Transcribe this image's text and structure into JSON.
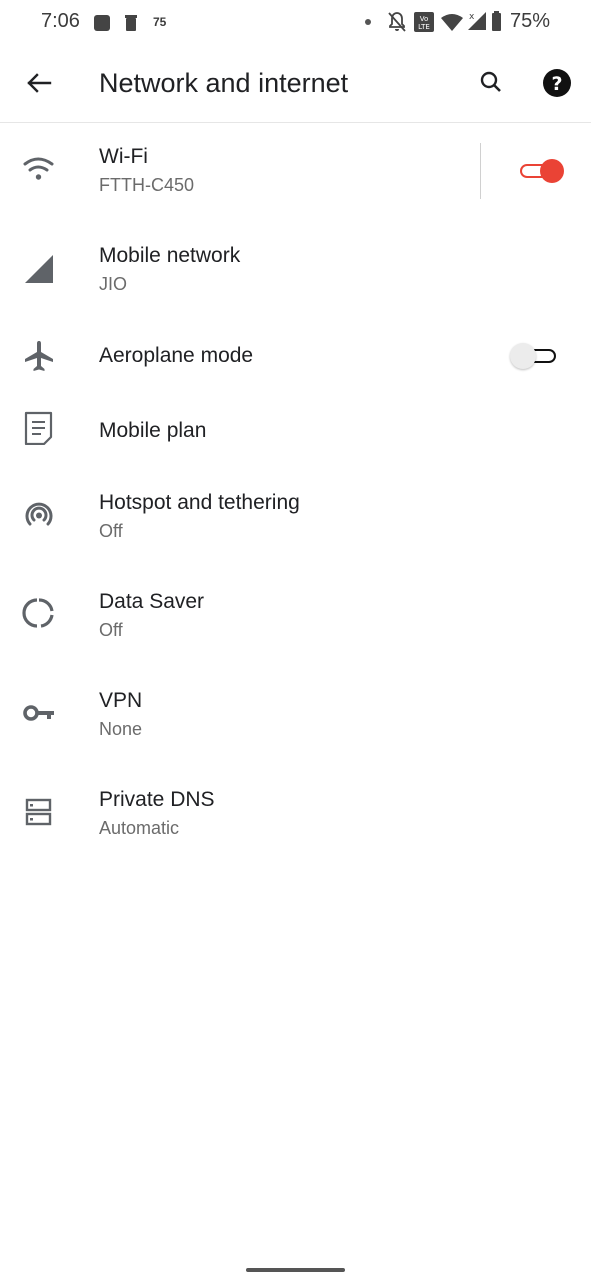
{
  "status_bar": {
    "time": "7:06",
    "notification_count": "75",
    "battery": "75%",
    "icons": [
      "notification-square-icon",
      "trash-icon",
      "dot-icon",
      "bell-off-icon",
      "volte-icon",
      "wifi-icon",
      "signal-icon",
      "battery-icon"
    ]
  },
  "app_bar": {
    "title": "Network and internet",
    "icons": [
      "back-arrow-icon",
      "search-icon",
      "help-icon"
    ]
  },
  "settings": [
    {
      "title": "Wi-Fi",
      "subtitle": "FTTH-C450",
      "icon": "wifi-icon",
      "toggle": "on"
    },
    {
      "title": "Mobile network",
      "subtitle": "JIO",
      "icon": "cell-signal-icon"
    },
    {
      "title": "Aeroplane mode",
      "icon": "airplane-icon",
      "toggle": "off"
    },
    {
      "title": "Mobile plan",
      "icon": "mobile-plan-icon"
    },
    {
      "title": "Hotspot and tethering",
      "subtitle": "Off",
      "icon": "hotspot-icon"
    },
    {
      "title": "Data Saver",
      "subtitle": "Off",
      "icon": "data-saver-icon"
    },
    {
      "title": "VPN",
      "subtitle": "None",
      "icon": "key-icon"
    },
    {
      "title": "Private DNS",
      "subtitle": "Automatic",
      "icon": "dns-icon"
    }
  ],
  "colors": {
    "accent": "#ea4335",
    "icon": "#5f6368",
    "text": "#202124",
    "secondary_text": "#6b6b6b"
  }
}
